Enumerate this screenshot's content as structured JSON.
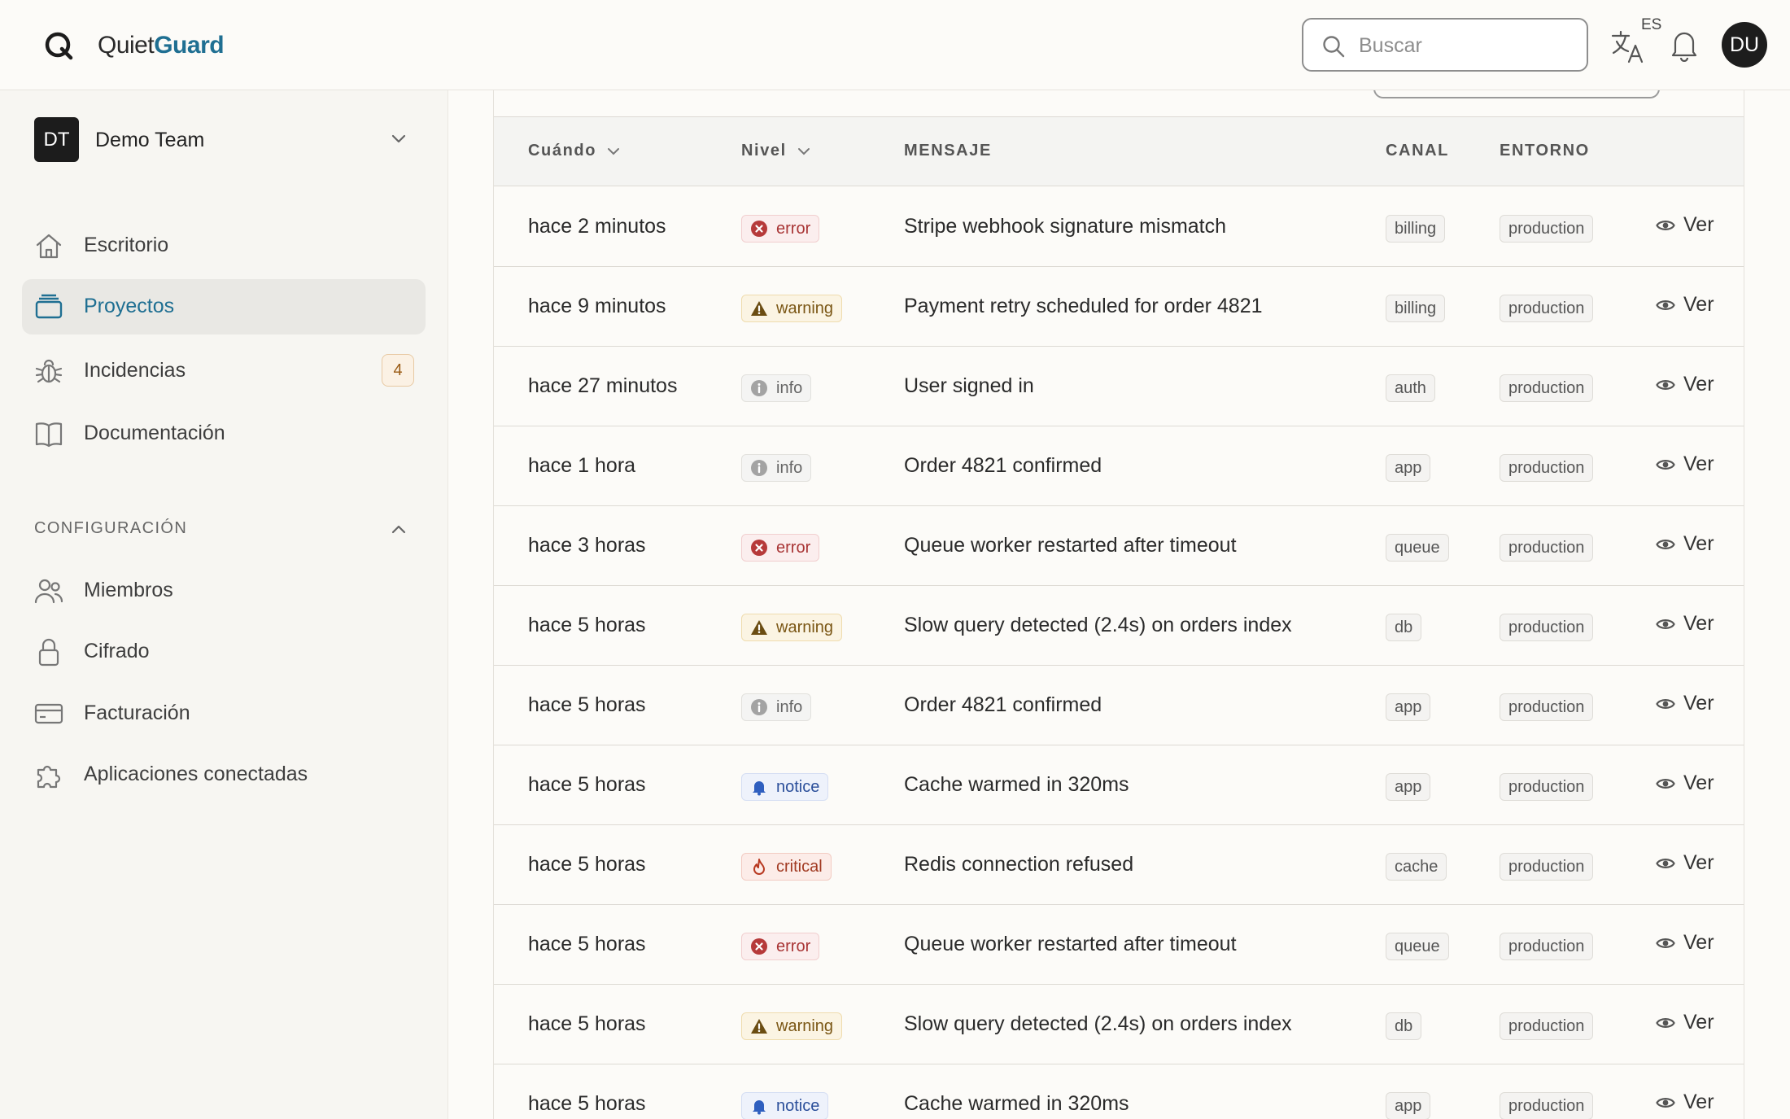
{
  "brand": {
    "name_part1": "Quiet",
    "name_part2": "Guard",
    "accent": "#1f6f92"
  },
  "header": {
    "search_placeholder": "Buscar",
    "language_badge": "ES",
    "user_initials": "DU",
    "icons": [
      "search-icon",
      "translate-icon",
      "bell-icon"
    ]
  },
  "sidebar": {
    "team": {
      "initials": "DT",
      "name": "Demo Team"
    },
    "nav": [
      {
        "label": "Escritorio",
        "icon": "home-icon"
      },
      {
        "label": "Proyectos",
        "icon": "folder-stack-icon",
        "active": true
      },
      {
        "label": "Incidencias",
        "icon": "bug-icon",
        "badge": "4"
      },
      {
        "label": "Documentación",
        "icon": "book-icon"
      }
    ],
    "config_section": {
      "title": "CONFIGURACIÓN",
      "items": [
        {
          "label": "Miembros",
          "icon": "users-icon"
        },
        {
          "label": "Cifrado",
          "icon": "lock-icon"
        },
        {
          "label": "Facturación",
          "icon": "credit-card-icon"
        },
        {
          "label": "Aplicaciones conectadas",
          "icon": "puzzle-icon"
        }
      ]
    }
  },
  "table": {
    "columns": {
      "when": "Cuándo",
      "level": "Nivel",
      "message": "MENSAJE",
      "channel": "CANAL",
      "environment": "ENTORNO"
    },
    "view_label": "Ver",
    "rows": [
      {
        "when": "hace 2 minutos",
        "level": "error",
        "message": "Stripe webhook signature mismatch",
        "channel": "billing",
        "env": "production"
      },
      {
        "when": "hace 9 minutos",
        "level": "warning",
        "message": "Payment retry scheduled for order 4821",
        "channel": "billing",
        "env": "production"
      },
      {
        "when": "hace 27 minutos",
        "level": "info",
        "message": "User signed in",
        "channel": "auth",
        "env": "production"
      },
      {
        "when": "hace 1 hora",
        "level": "info",
        "message": "Order 4821 confirmed",
        "channel": "app",
        "env": "production"
      },
      {
        "when": "hace 3 horas",
        "level": "error",
        "message": "Queue worker restarted after timeout",
        "channel": "queue",
        "env": "production"
      },
      {
        "when": "hace 5 horas",
        "level": "warning",
        "message": "Slow query detected (2.4s) on orders index",
        "channel": "db",
        "env": "production"
      },
      {
        "when": "hace 5 horas",
        "level": "info",
        "message": "Order 4821 confirmed",
        "channel": "app",
        "env": "production"
      },
      {
        "when": "hace 5 horas",
        "level": "notice",
        "message": "Cache warmed in 320ms",
        "channel": "app",
        "env": "production"
      },
      {
        "when": "hace 5 horas",
        "level": "critical",
        "message": "Redis connection refused",
        "channel": "cache",
        "env": "production"
      },
      {
        "when": "hace 5 horas",
        "level": "error",
        "message": "Queue worker restarted after timeout",
        "channel": "queue",
        "env": "production"
      },
      {
        "when": "hace 5 horas",
        "level": "warning",
        "message": "Slow query detected (2.4s) on orders index",
        "channel": "db",
        "env": "production"
      },
      {
        "when": "hace 5 horas",
        "level": "notice",
        "message": "Cache warmed in 320ms",
        "channel": "app",
        "env": "production"
      }
    ]
  }
}
